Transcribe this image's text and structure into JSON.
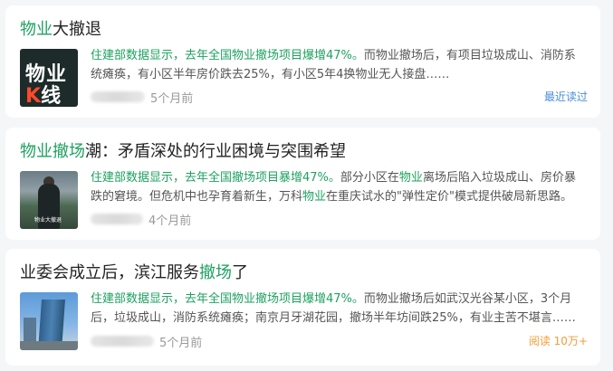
{
  "articles": [
    {
      "title_highlight": "物业",
      "title_rest": "大撤退",
      "summary_lead": "住建部数据显示，去年全国物业撤场项目爆增47%。",
      "summary_rest": "而物业撤场后，有项目垃圾成山、消防系统瘫痪，有小区半年房价跌去25%，有小区5年4换物业无人接盘……",
      "time": "5个月前",
      "badge": "最近读过",
      "thumb_text_1": "物业",
      "thumb_text_k": "K",
      "thumb_text_2": "线"
    },
    {
      "title_highlight": "物业撤场",
      "title_rest": "潮：矛盾深处的行业困境与突围希望",
      "summary_lead": "住建部数据显示，去年全国撤场项目暴增47%。",
      "summary_p1": "部分小区在",
      "summary_kw1": "物业",
      "summary_p2": "离场后陷入垃圾成山、房价暴跌的窘境。但危机中也孕育着新生，万科",
      "summary_kw2": "物业",
      "summary_p3": "在重庆试水的\"弹性定价\"模式提供破局新思路。",
      "time": "4个月前",
      "thumb_caption": "物业大撤退"
    },
    {
      "title_pre": "业委会成立后，滨江服务",
      "title_highlight": "撤场",
      "title_post": "了",
      "summary_lead": "住建部数据显示，去年全国物业撤场项目爆增47%。",
      "summary_rest": "而物业撤场后如武汉光谷某小区，3个月后，垃圾成山，消防系统瘫痪；南京月牙湖花园，撤场半年坊间跌25%，有业主苦不堪言……",
      "time": "5个月前",
      "badge": "阅读 10万+"
    }
  ],
  "colors": {
    "accent": "#1ea160",
    "read_badge": "#4a8ed8",
    "views_badge": "#f39c38"
  }
}
